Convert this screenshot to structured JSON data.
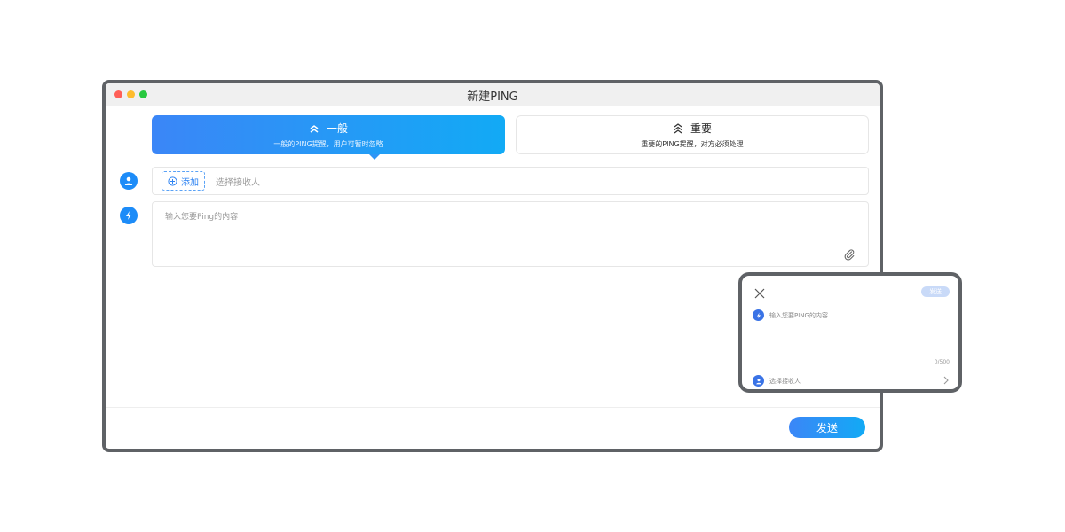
{
  "window": {
    "title": "新建PING"
  },
  "ping_types": [
    {
      "label": "一般",
      "description": "一般的PING提醒，用户可暂时忽略",
      "selected": true,
      "icon": "double-chevron-up-icon"
    },
    {
      "label": "重要",
      "description": "重要的PING提醒，对方必须处理",
      "selected": false,
      "icon": "triple-chevron-up-icon"
    }
  ],
  "recipient": {
    "add_label": "添加",
    "placeholder": "选择接收人"
  },
  "message": {
    "placeholder": "输入您要Ping的内容"
  },
  "footer": {
    "send_label": "发送"
  },
  "mobile": {
    "send_label": "发送",
    "message_placeholder": "输入您要PING的内容",
    "counter": "0/500",
    "recipient_placeholder": "选择接收人"
  },
  "colors": {
    "accent": "#1d8cf8",
    "gradient_start": "#3b86f7",
    "gradient_end": "#12aaf5",
    "frame": "#5f6266"
  }
}
